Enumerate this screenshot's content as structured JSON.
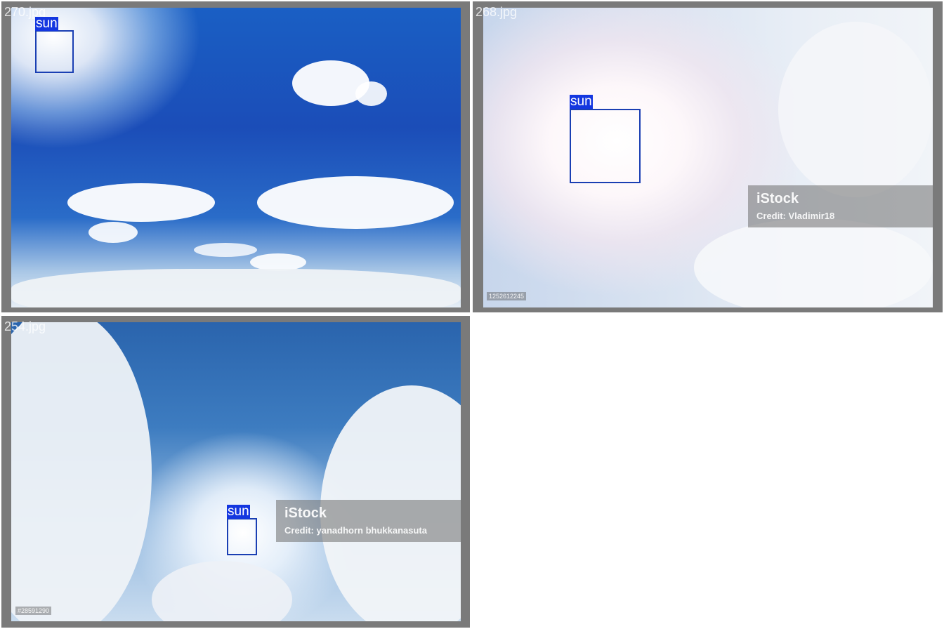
{
  "tiles": [
    {
      "filename": "270.jpg",
      "box_label": "sun",
      "stock_id": ""
    },
    {
      "filename": "268.jpg",
      "box_label": "sun",
      "watermark": {
        "brand": "iStock",
        "credit": "Credit: Vladimir18"
      },
      "stock_id": "1252612245"
    },
    {
      "filename": "254.jpg",
      "box_label": "sun",
      "watermark": {
        "brand": "iStock",
        "credit": "Credit: yanadhorn bhukkanasuta"
      },
      "stock_id": "#28591290"
    }
  ],
  "colors": {
    "tile_frame": "#7a7a7a",
    "box_stroke": "#1a3fb3",
    "label_bg": "#1437e0"
  }
}
